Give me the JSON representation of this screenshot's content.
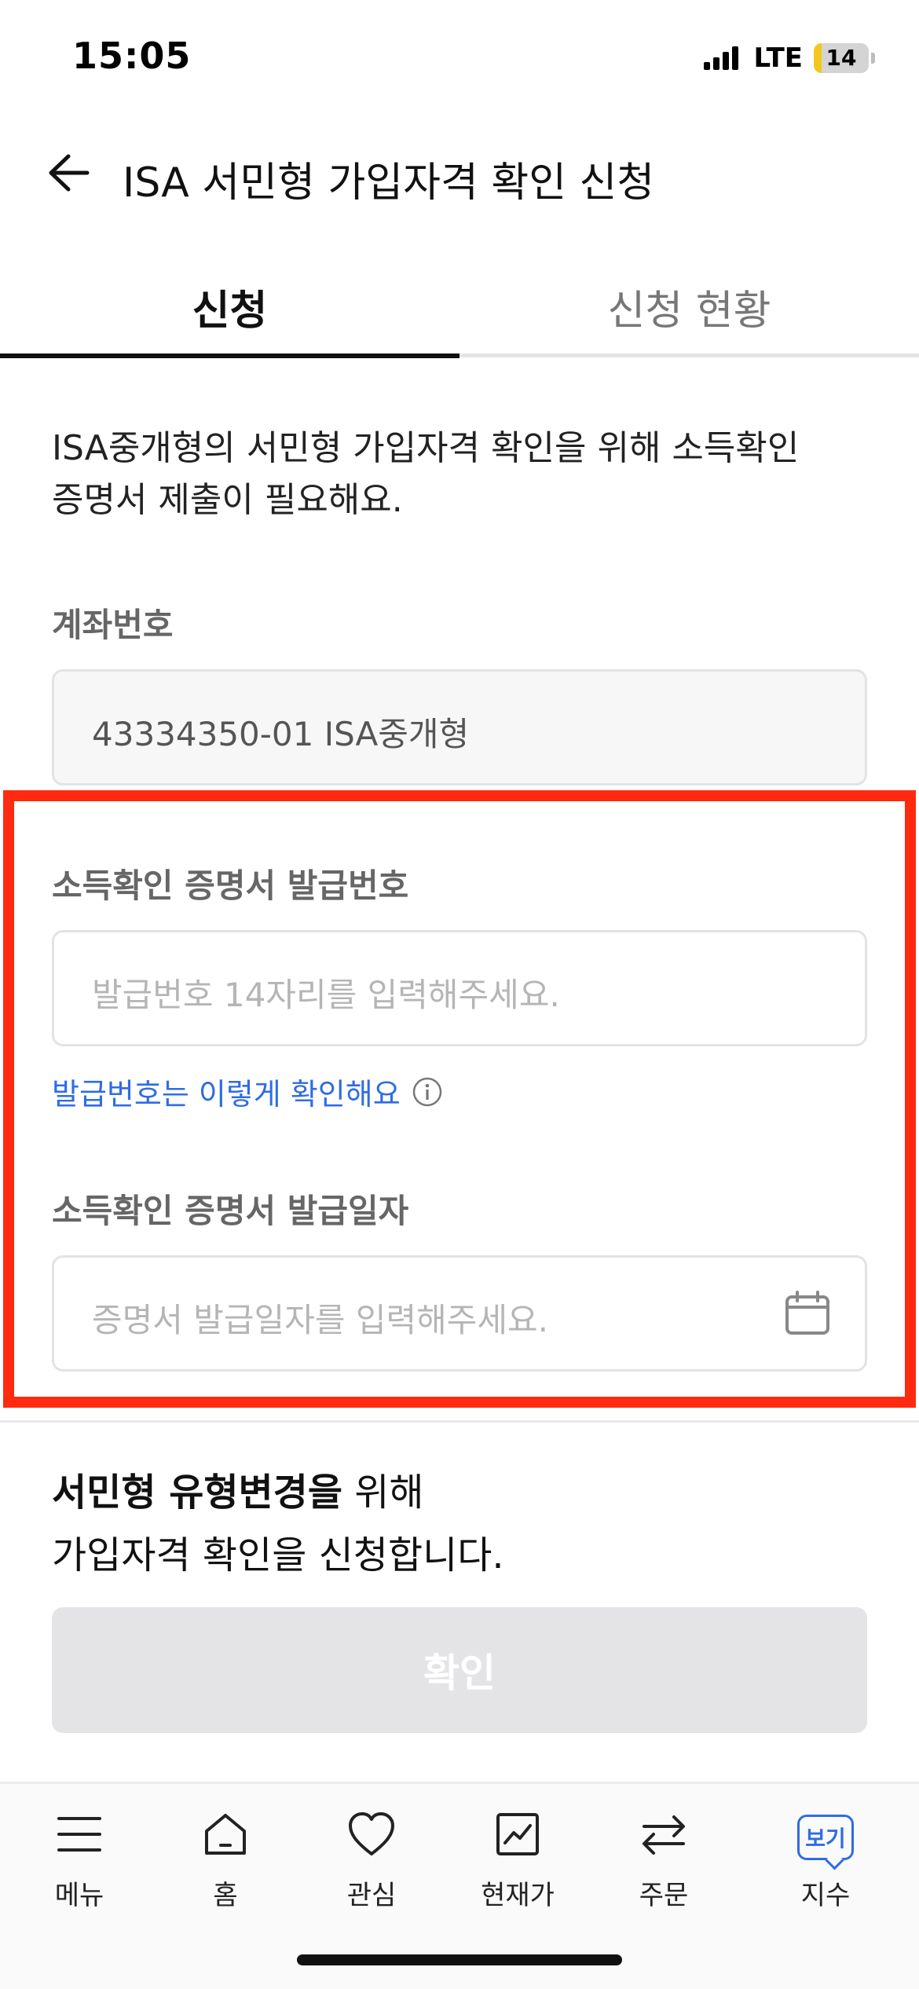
{
  "status_bar": {
    "time": "15:05",
    "network": "LTE",
    "battery": "14",
    "battery_level_percent": 14
  },
  "header": {
    "back_icon": "arrow-left-icon",
    "title": "ISA 서민형 가입자격 확인 신청"
  },
  "tabs": [
    {
      "label": "신청",
      "active": true
    },
    {
      "label": "신청 현황",
      "active": false
    }
  ],
  "intro": {
    "line1": "ISA중개형의 서민형 가입자격 확인을 위해 소득확인",
    "line2": "증명서 제출이 필요해요."
  },
  "account": {
    "label": "계좌번호",
    "value": "43334350-01 ISA중개형"
  },
  "issue_number": {
    "label": "소득확인 증명서 발급번호",
    "placeholder": "발급번호 14자리를 입력해주세요.",
    "help_link": "발급번호는 이렇게 확인해요",
    "help_icon": "info-icon"
  },
  "issue_date": {
    "label": "소득확인 증명서 발급일자",
    "placeholder": "증명서 발급일자를 입력해주세요.",
    "icon": "calendar-icon"
  },
  "notice": {
    "bold": "서민형 유형변경을",
    "rest": " 위해",
    "line2": "가입자격 확인을 신청합니다."
  },
  "confirm_button": {
    "label": "확인",
    "enabled": false
  },
  "colors": {
    "accent_blue": "#2f6ce5",
    "highlight_red": "#ff2a10",
    "disabled_button": "#e4e4e6"
  },
  "bottom_nav": {
    "items": [
      {
        "label": "메뉴",
        "icon": "menu-icon"
      },
      {
        "label": "홈",
        "icon": "home-icon"
      },
      {
        "label": "관심",
        "icon": "heart-icon"
      },
      {
        "label": "현재가",
        "icon": "chart-icon"
      },
      {
        "label": "주문",
        "icon": "swap-arrows-icon"
      },
      {
        "label": "지수",
        "icon": "view-badge-icon",
        "badge": "보기"
      }
    ]
  }
}
